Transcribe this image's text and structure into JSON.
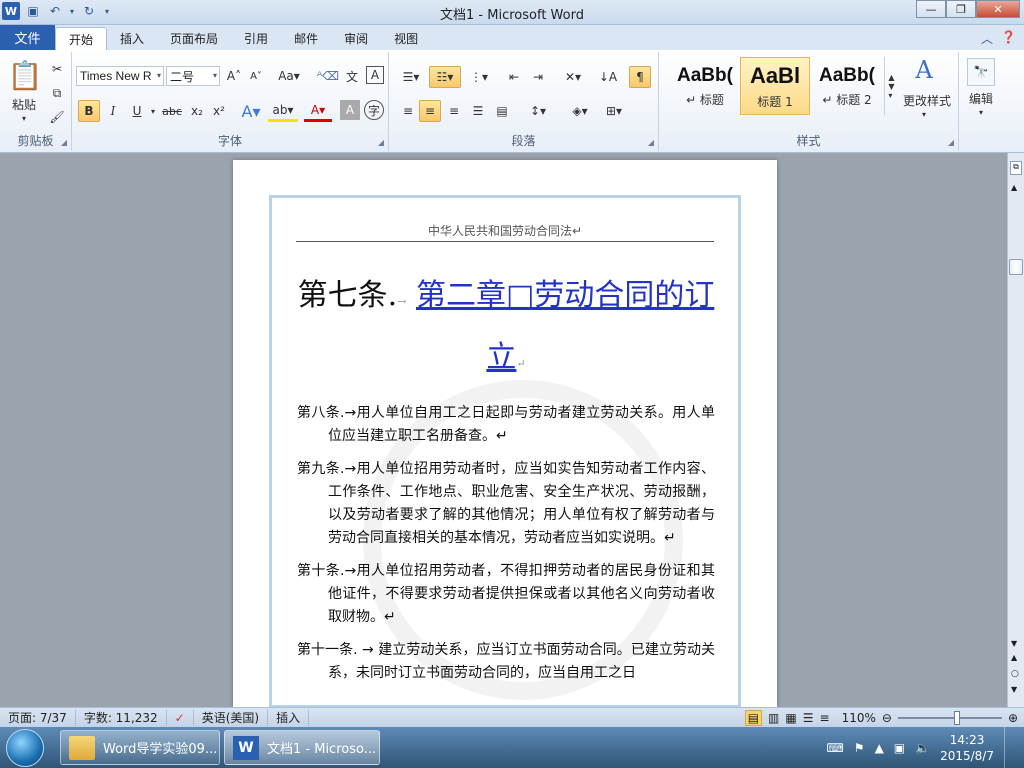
{
  "window": {
    "title": "文档1 - Microsoft Word"
  },
  "qat": {
    "logo": "W",
    "save_icon": "save-icon",
    "undo_icon": "undo-icon",
    "redo_icon": "redo-icon"
  },
  "tabs": {
    "file": "文件",
    "items": [
      "开始",
      "插入",
      "页面布局",
      "引用",
      "邮件",
      "审阅",
      "视图"
    ],
    "active": "开始"
  },
  "ribbon": {
    "clipboard": {
      "label": "剪贴板",
      "paste": "粘贴"
    },
    "font": {
      "label": "字体",
      "font_name": "Times New R",
      "font_size": "二号"
    },
    "paragraph": {
      "label": "段落"
    },
    "styles": {
      "label": "样式",
      "items": [
        {
          "preview": "AaBb(",
          "name": "↵ 标题"
        },
        {
          "preview": "AaBl",
          "name": "标题 1"
        },
        {
          "preview": "AaBb(",
          "name": "↵ 标题 2"
        }
      ],
      "change_styles": "更改样式"
    },
    "editing": {
      "label": "编辑"
    }
  },
  "document": {
    "header": "中华人民共和国劳动合同法↵",
    "heading_num": "第七条.",
    "heading_link": "第二章□劳动合同的订立",
    "paragraphs": [
      "第八条.→用人单位自用工之日起即与劳动者建立劳动关系。用人单位应当建立职工名册备查。↵",
      "第九条.→用人单位招用劳动者时，应当如实告知劳动者工作内容、工作条件、工作地点、职业危害、安全生产状况、劳动报酬，以及劳动者要求了解的其他情况；用人单位有权了解劳动者与劳动合同直接相关的基本情况，劳动者应当如实说明。↵",
      "第十条.→用人单位招用劳动者，不得扣押劳动者的居民身份证和其他证件，不得要求劳动者提供担保或者以其他名义向劳动者收取财物。↵",
      "第十一条. → 建立劳动关系，应当订立书面劳动合同。已建立劳动关系，未同时订立书面劳动合同的，应当自用工之日"
    ]
  },
  "status": {
    "page": "页面: 7/37",
    "words": "字数: 11,232",
    "lang": "英语(美国)",
    "mode": "插入",
    "zoom": "110%"
  },
  "taskbar": {
    "items": [
      {
        "label": "Word导学实验09..."
      },
      {
        "label": "文档1 - Microso..."
      }
    ],
    "time": "14:23",
    "date": "2015/8/7"
  }
}
